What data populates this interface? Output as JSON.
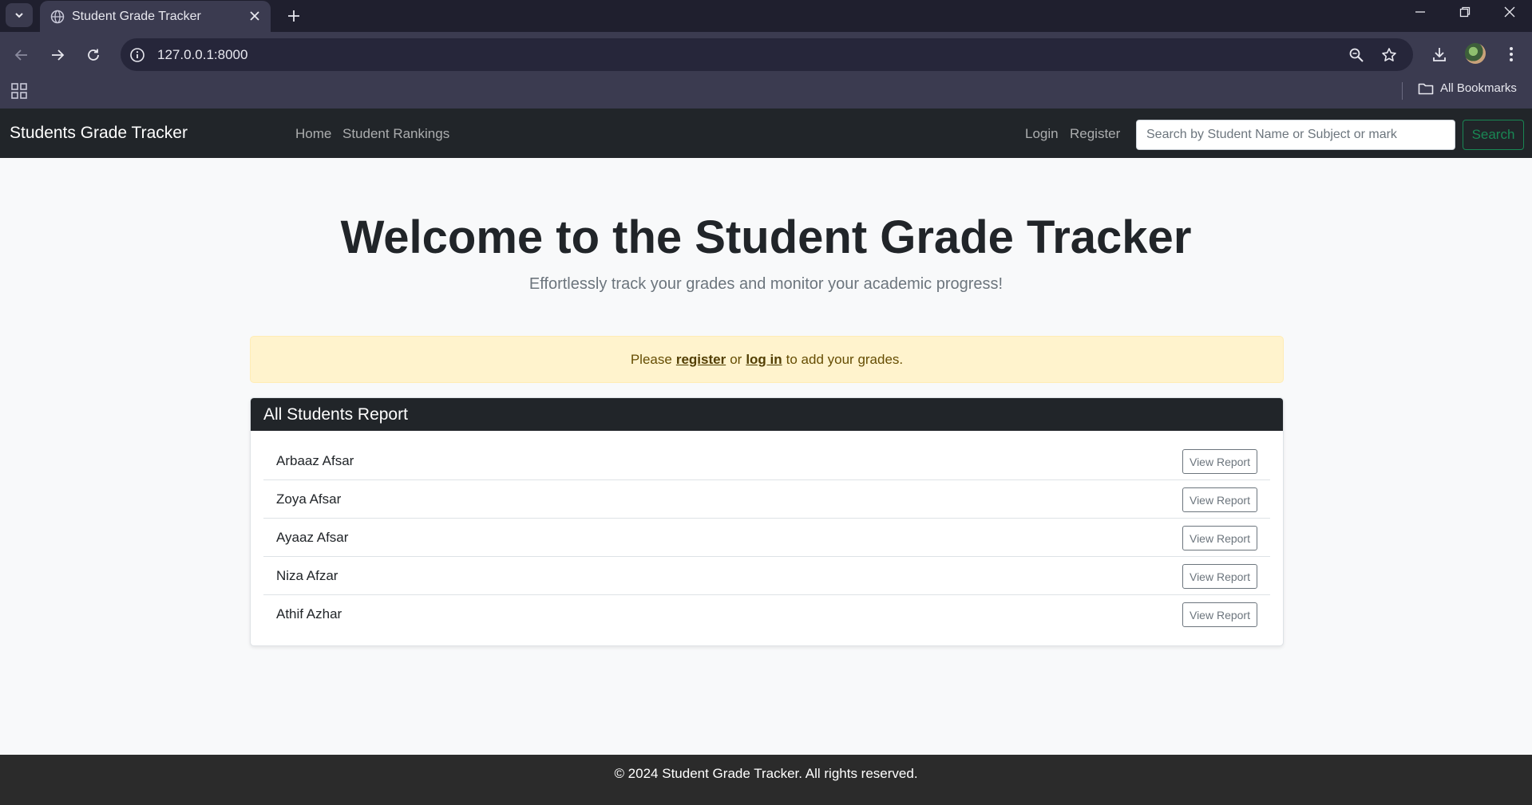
{
  "browser": {
    "tab_title": "Student Grade Tracker",
    "url": "127.0.0.1:8000",
    "bookmarks_label": "All Bookmarks"
  },
  "navbar": {
    "brand": "Students Grade Tracker",
    "links": [
      "Home",
      "Student Rankings"
    ],
    "login": "Login",
    "register": "Register",
    "search_placeholder": "Search by Student Name or Subject or mark",
    "search_button": "Search"
  },
  "hero": {
    "title": "Welcome to the Student Grade Tracker",
    "subtitle": "Effortlessly track your grades and monitor your academic progress!"
  },
  "alert": {
    "prefix": "Please",
    "register_link": "register",
    "middle": "or",
    "login_link": "log in",
    "suffix": "to add your grades."
  },
  "report": {
    "title": "All Students Report",
    "view_label": "View Report",
    "students": [
      "Arbaaz Afsar",
      "Zoya Afsar",
      "Ayaaz Afsar",
      "Niza Afzar",
      "Athif Azhar"
    ]
  },
  "footer": {
    "text": "© 2024 Student Grade Tracker. All rights reserved."
  }
}
